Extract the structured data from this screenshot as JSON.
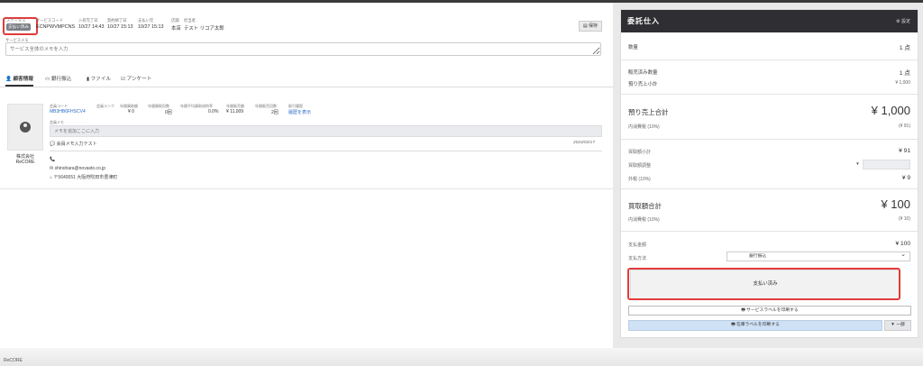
{
  "header": {
    "status_label": "ステータス",
    "status_value": "支払い済み",
    "service_code_label": "サービスコード",
    "service_code_value": "ECNPWVMPCNS",
    "arrival_label": "入荷完了日",
    "arrival_value": "10/27 14:43",
    "contract_label": "契約締了日",
    "contract_value": "10/27 15:13",
    "payment_label": "支払い完",
    "payment_value": "10/27 15:13",
    "store_label": "店舗",
    "store_value": "本店",
    "staff_label": "担当者",
    "staff_value": "テスト リコア太郎",
    "save_label": "保存",
    "memo_label": "サービスメモ",
    "memo_placeholder": "サービス全体のメモを入力"
  },
  "tabs": [
    {
      "label": "顧客情報"
    },
    {
      "label": "銀行振込"
    },
    {
      "label": "ファイル"
    },
    {
      "label": "アンケート"
    }
  ],
  "customer": {
    "company": "株式会社 ReCORE",
    "member_code_label": "会員コード",
    "member_code_value": "MB3HB6FHSCV4",
    "rank_label": "会員ランク",
    "rank_value": "",
    "annual_purchase_label": "年間買取額",
    "annual_purchase_value": "¥ 0",
    "annual_purchase_count_label": "年間買取回数",
    "annual_purchase_count_value": "0回",
    "annual_avg_rate_label": "年間平均買取成約率",
    "annual_avg_rate_value": "0.0%",
    "annual_sales_label": "年間販売額",
    "annual_sales_value": "¥ 11,009",
    "annual_sales_count_label": "年間販売回数",
    "annual_sales_count_value": "2回",
    "history_label": "取引履歴",
    "history_link": "履歴を表示",
    "memo_label": "会員メモ",
    "memo_placeholder": "メモを追加ここに入力",
    "memo_note": "会員メモ入力テスト",
    "memo_date": "2024/03/17",
    "phone": "",
    "email": "shinohara@novasto.co.jp",
    "address": "〒5640051 大阪府吹田市豊津町"
  },
  "panel": {
    "title": "委託仕入",
    "settings_label": "設定",
    "quantity_label": "数量",
    "quantity_value": "1 点",
    "sold_qty_label": "販売済み数量",
    "sold_qty_value": "1 点",
    "expected_subtotal_label": "預り売上小計",
    "expected_subtotal_value": "¥ 1,000",
    "expected_total_label": "預り売上合計",
    "expected_total_value": "¥ 1,000",
    "expected_tax_label": "内消費税 (10%)",
    "expected_tax_value": "(¥ 91)",
    "purchase_subtotal_label": "買取額小計",
    "purchase_subtotal_value": "¥ 91",
    "adjust_label": "買取額調整",
    "adjust_dropdown": "▼",
    "tax_exclusive_label": "外税 (10%)",
    "tax_exclusive_value": "¥ 9",
    "purchase_total_label": "買取額合計",
    "purchase_total_value": "¥ 100",
    "purchase_tax_label": "内消費税 (10%)",
    "purchase_tax_value": "(¥ 10)",
    "payment_amount_label": "支払金額",
    "payment_amount_value": "¥ 100",
    "payment_method_label": "支払方法",
    "payment_method_value": "銀行振込",
    "paid_button": "支払い済み",
    "service_label_button": "サービスラベルを印刷する",
    "stock_label_button": "在庫ラベルを印刷する",
    "part_button": "一部"
  },
  "footer": {
    "text": "ReCORE"
  },
  "colors": {
    "highlight": "#e23b3b",
    "link": "#2a6cc6",
    "header_dark": "#2f2f33",
    "accent_blue": "#cfe1f5"
  }
}
